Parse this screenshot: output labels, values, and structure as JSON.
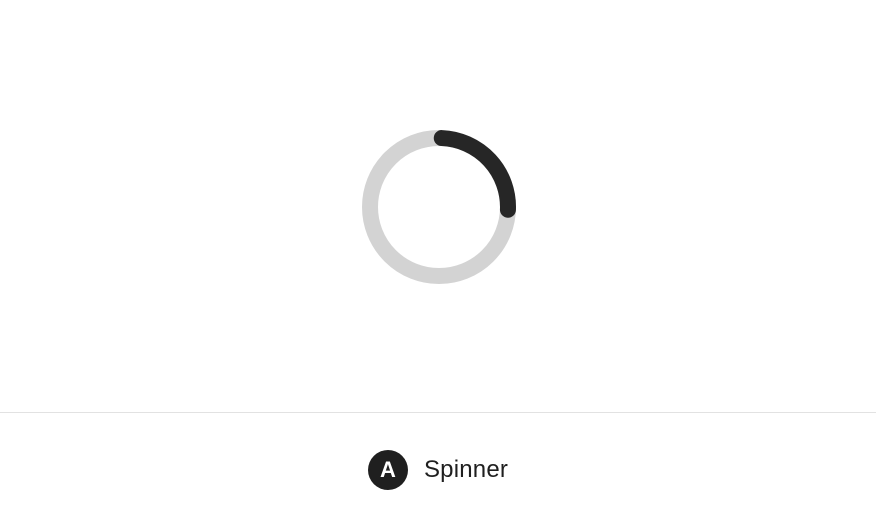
{
  "spinner": {
    "icon": "spinner-icon",
    "progress": 0.25,
    "track_color": "#d3d3d3",
    "arc_color": "#262626"
  },
  "caption": {
    "badge_letter": "A",
    "label": "Spinner",
    "badge_color": "#1f1f1f"
  }
}
